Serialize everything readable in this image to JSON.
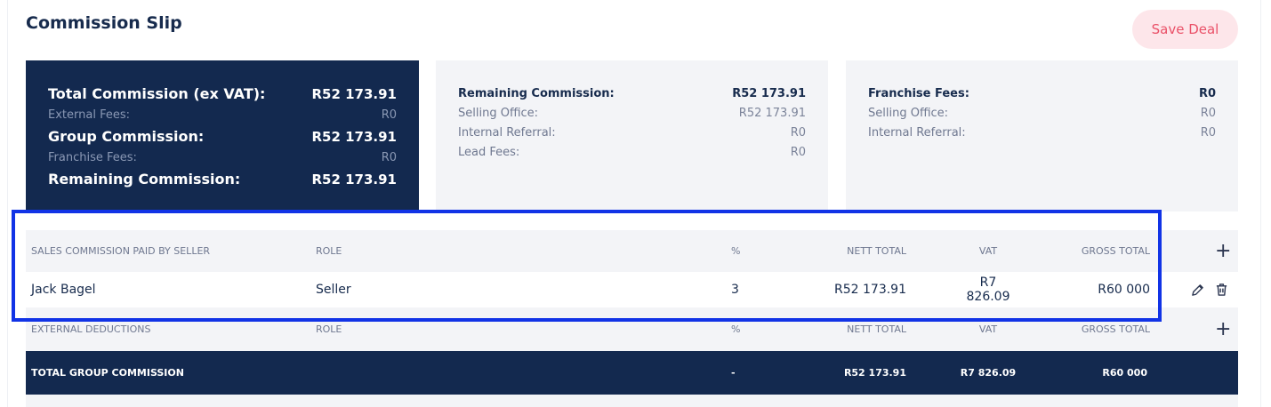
{
  "page": {
    "title": "Commission Slip",
    "save_label": "Save Deal"
  },
  "summary": {
    "total_commission": {
      "label": "Total Commission (ex VAT):",
      "value": "R52 173.91"
    },
    "external_fees": {
      "label": "External Fees:",
      "value": "R0"
    },
    "group_commission": {
      "label": "Group Commission:",
      "value": "R52 173.91"
    },
    "franchise_fees": {
      "label": "Franchise Fees:",
      "value": "R0"
    },
    "remaining_commission": {
      "label": "Remaining Commission:",
      "value": "R52 173.91"
    }
  },
  "remaining": {
    "head": {
      "label": "Remaining Commission:",
      "value": "R52 173.91"
    },
    "selling_office": {
      "label": "Selling Office:",
      "value": "R52 173.91"
    },
    "internal_referral": {
      "label": "Internal Referral:",
      "value": "R0"
    },
    "lead_fees": {
      "label": "Lead Fees:",
      "value": "R0"
    }
  },
  "franchise": {
    "head": {
      "label": "Franchise Fees:",
      "value": "R0"
    },
    "selling_office": {
      "label": "Selling Office:",
      "value": "R0"
    },
    "internal_referral": {
      "label": "Internal Referral:",
      "value": "R0"
    }
  },
  "sales_table": {
    "headers": {
      "name": "SALES COMMISSION PAID BY SELLER",
      "role": "ROLE",
      "pct": "%",
      "nett": "NETT TOTAL",
      "vat": "VAT",
      "gross": "GROSS TOTAL"
    },
    "rows": [
      {
        "name": "Jack Bagel",
        "role": "Seller",
        "pct": "3",
        "nett": "R52 173.91",
        "vat": "R7 826.09",
        "gross": "R60 000"
      }
    ]
  },
  "external_table": {
    "headers": {
      "name": "EXTERNAL DEDUCTIONS",
      "role": "ROLE",
      "pct": "%",
      "nett": "NETT TOTAL",
      "vat": "VAT",
      "gross": "GROSS TOTAL"
    }
  },
  "total_row": {
    "label": "TOTAL GROUP COMMISSION",
    "pct": "-",
    "nett": "R52 173.91",
    "vat": "R7 826.09",
    "gross": "R60 000"
  },
  "icons": {
    "add": "plus-icon",
    "edit": "pencil-icon",
    "delete": "trash-icon"
  },
  "colors": {
    "navy": "#13294f",
    "save_bg": "#fde6ea",
    "save_text": "#ea5168",
    "highlight": "#1133e6",
    "panel": "#f3f4f7"
  }
}
